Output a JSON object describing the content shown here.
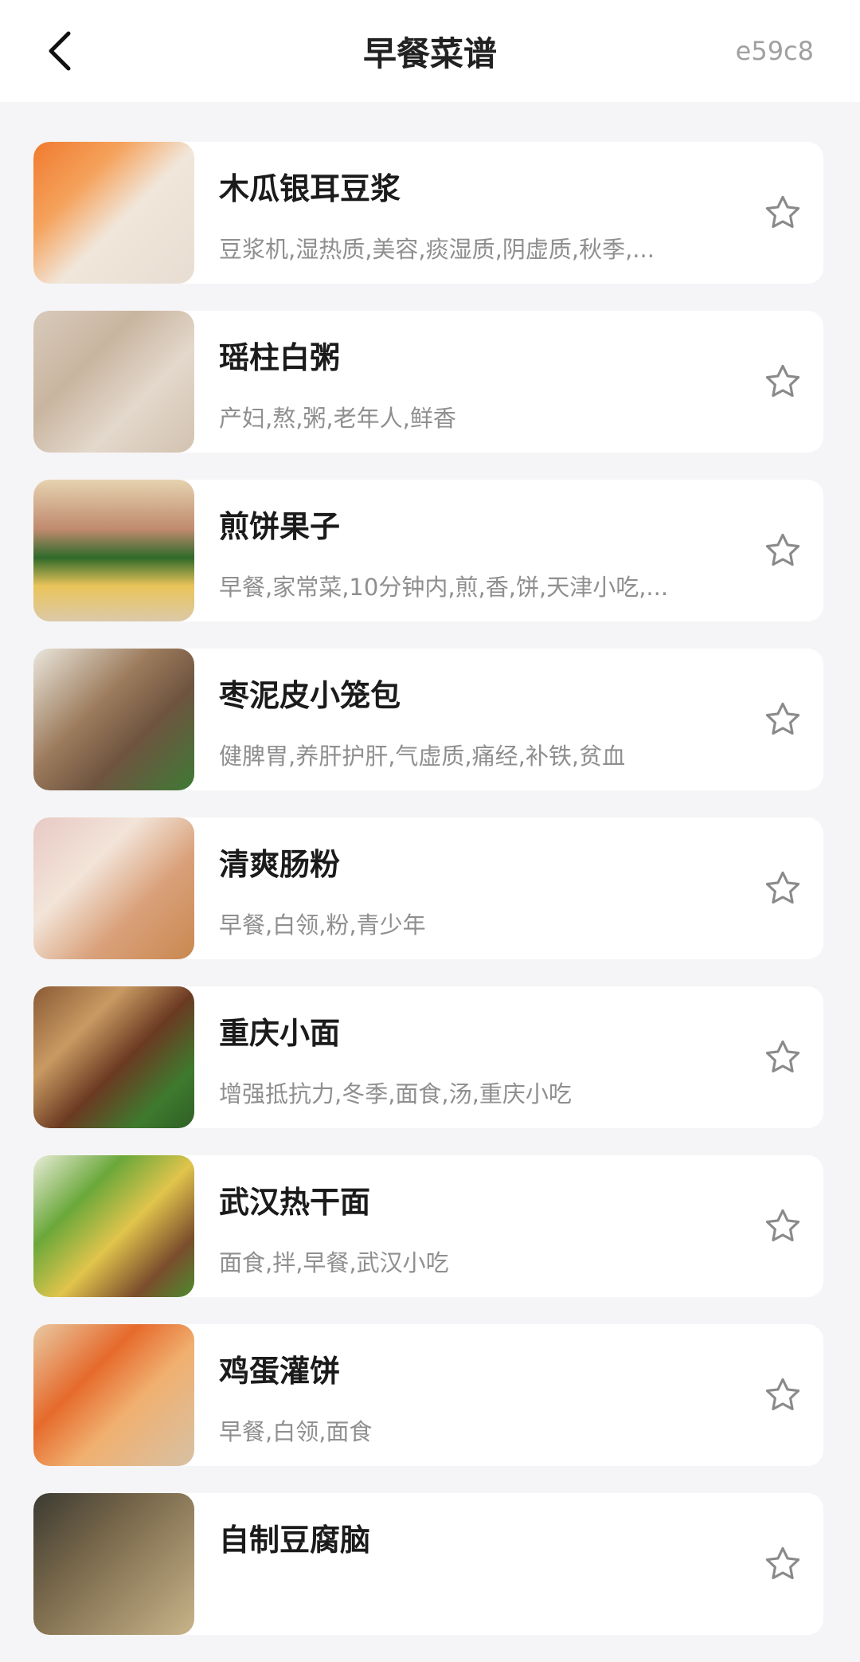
{
  "header": {
    "title": "早餐菜谱",
    "code": "e59c8",
    "back_icon": "chevron-left-icon"
  },
  "colors": {
    "background": "#f5f5f7",
    "card": "#ffffff",
    "title": "#222222",
    "tags": "#8f8f8f",
    "star": "#8a8a8a"
  },
  "recipes": [
    {
      "name": "木瓜银耳豆浆",
      "tags": "豆浆机,湿热质,美容,痰湿质,阴虚质,秋季,...",
      "thumb": "linear-gradient(135deg,#f07a2e 0%,#f5a25c 30%,#f1e6da 55%,#e8ddd2 100%)"
    },
    {
      "name": "瑶柱白粥",
      "tags": "产妇,熬,粥,老年人,鲜香",
      "thumb": "linear-gradient(135deg,#d8cabc 0%,#c9b59f 35%,#e3d8cc 65%,#d2c2b0 100%)"
    },
    {
      "name": "煎饼果子",
      "tags": "早餐,家常菜,10分钟内,煎,香,饼,天津小吃,...",
      "thumb": "linear-gradient(180deg,#e6d3b0 0%,#c08a6e 35%,#2f6a2a 55%,#e9c45a 75%,#dcc9a8 100%)"
    },
    {
      "name": "枣泥皮小笼包",
      "tags": "健脾胃,养肝护肝,气虚质,痛经,补铁,贫血",
      "thumb": "linear-gradient(135deg,#eae6dc 0%,#9c7b5c 40%,#6e5440 65%,#3f7a35 100%)"
    },
    {
      "name": "清爽肠粉",
      "tags": "早餐,白领,粉,青少年",
      "thumb": "linear-gradient(135deg,#e8c9c5 0%,#f2e4d8 35%,#d9a07a 65%,#c9884f 100%)"
    },
    {
      "name": "重庆小面",
      "tags": "增强抵抗力,冬季,面食,汤,重庆小吃",
      "thumb": "linear-gradient(135deg,#8a5a36 0%,#c99a62 30%,#6b3a22 55%,#3e7a2e 80%,#2f5f24 100%)"
    },
    {
      "name": "武汉热干面",
      "tags": "面食,拌,早餐,武汉小吃",
      "thumb": "linear-gradient(135deg,#e9ecd8 0%,#6aa83a 30%,#e0c44c 55%,#7a4d2c 80%,#4e8a2f 100%)"
    },
    {
      "name": "鸡蛋灌饼",
      "tags": "早餐,白领,面食",
      "thumb": "linear-gradient(135deg,#e8c9a2 0%,#e66a2c 35%,#f0b070 60%,#d7c1a5 100%)"
    },
    {
      "name": "自制豆腐脑",
      "tags": "",
      "thumb": "linear-gradient(135deg,#3c3a32 0%,#7b6a4c 40%,#c9b48a 100%)"
    }
  ]
}
